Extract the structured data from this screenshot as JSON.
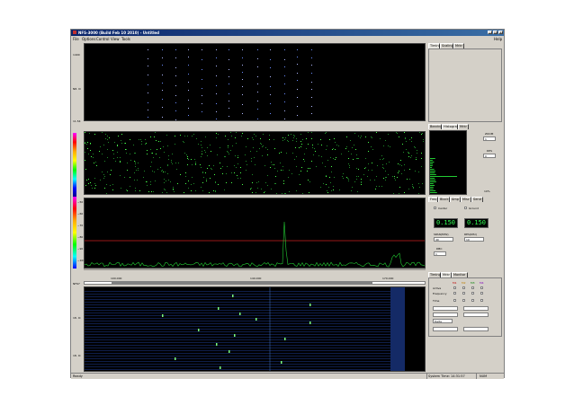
{
  "window": {
    "title": "NFS-3000 (Build Feb 10 2010) - Untitled",
    "min": "_",
    "max": "□",
    "close": "x"
  },
  "menu": {
    "items": [
      "File",
      "Options",
      "Control",
      "View",
      "Tools"
    ],
    "help": "Help"
  },
  "top_panel": {
    "ylabels": [
      "1400",
      "N8. IC",
      "11.54"
    ]
  },
  "spectrum_panel": {
    "ylabels": [
      "~50",
      "~60",
      "~70",
      "~80",
      "~90",
      "~100"
    ]
  },
  "freq_axis": {
    "labels": [
      "100.000",
      "140.000",
      "170.000"
    ],
    "left_label": "NF67"
  },
  "bottom_panel": {
    "ylabels": [
      "18. IC",
      "18. IC"
    ]
  },
  "right_top_tabs": [
    "Timing",
    "Scaling",
    "Mrkr"
  ],
  "right_mid_tabs": [
    "Bearing",
    "Histogram",
    "Mrkr"
  ],
  "histogram": {
    "zoom_label": "ZOOM",
    "zoom_value": "1",
    "dps_label": "DPS",
    "dps_value": "0",
    "pct_label": "10%"
  },
  "right_ctrl_tabs": [
    "Freq",
    "Block",
    "Amp",
    "Misc",
    "Send"
  ],
  "freq_ctrl": {
    "center_label": "Center",
    "ground_label": "Ground",
    "led_left": "0.150",
    "led_right": "0.150",
    "span_label": "SPAN(MHz)",
    "res_label": "RES(KHz)",
    "span_value": "40",
    "res_value": "10",
    "dbc_label": "DBC",
    "dbc_value": "1"
  },
  "right_bottom_tabs": [
    "Timing",
    "Mrkr",
    "Monitor"
  ],
  "marker_ctrl": {
    "headers": [
      "M1",
      "M2",
      "M3",
      "M4"
    ],
    "rows": [
      "Active",
      "Frequency",
      "Time"
    ],
    "dropdown": "Delta"
  },
  "status": {
    "left": "Ready",
    "time": "System Time: 14:31:57",
    "mode": "NUM"
  },
  "colors": {
    "titlebar": "#0a246a",
    "dialog": "#d4d0c8",
    "trace": "#22cc33",
    "threshold": "#cc2222",
    "led": "#33ff55"
  }
}
